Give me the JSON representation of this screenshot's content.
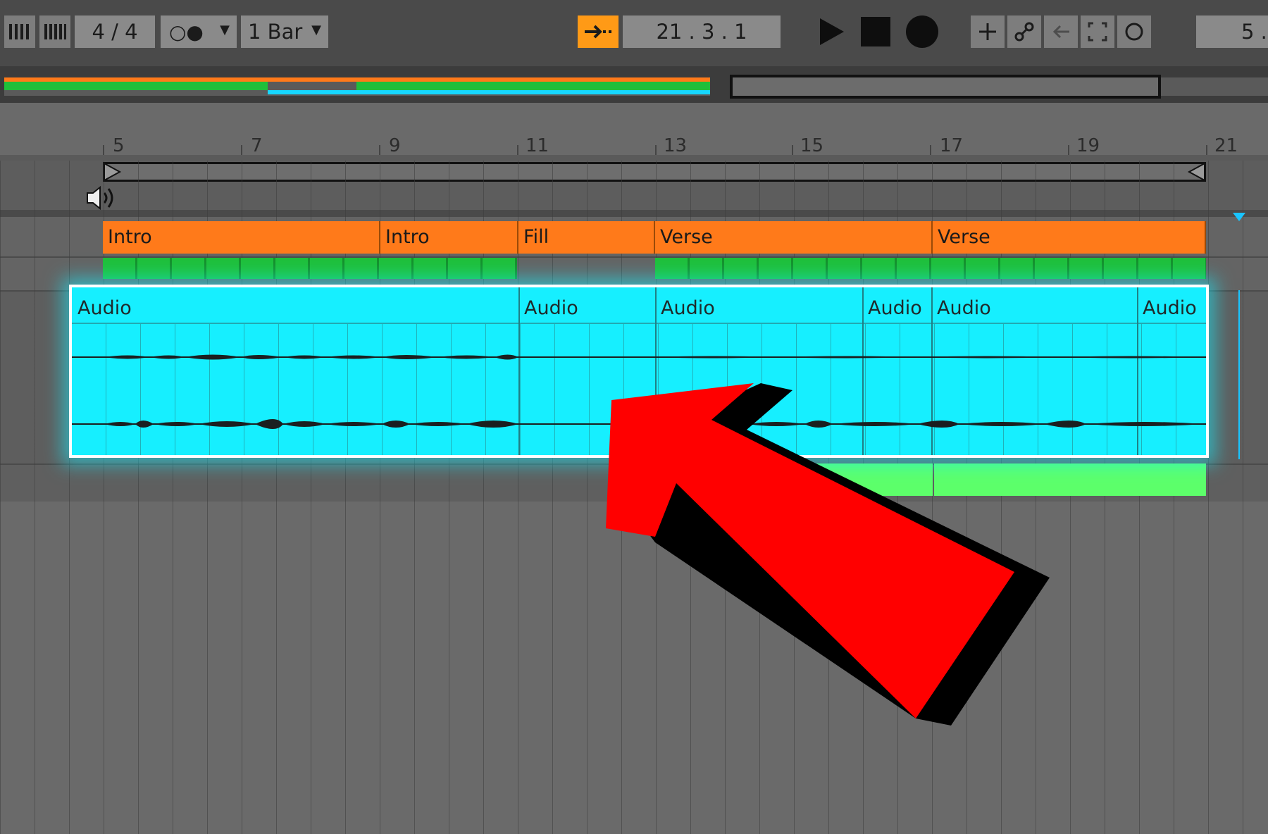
{
  "toolbar": {
    "time_signature": "4 / 4",
    "follow_glyph": "○●",
    "quantize": "1 Bar",
    "position": "21 .  3 .  1",
    "right_partial": "5 ."
  },
  "ruler": {
    "labels": [
      "5",
      "7",
      "9",
      "11",
      "13",
      "15",
      "17",
      "19",
      "21"
    ]
  },
  "sections": [
    "Intro",
    "Intro",
    "Fill",
    "Verse",
    "Verse"
  ],
  "audio_clips": [
    "Audio",
    "Audio",
    "Audio",
    "Audio",
    "Audio",
    "Audio"
  ],
  "colors": {
    "accent": "#ff8a00",
    "section": "#ff7a1a",
    "clip": "#16efff",
    "green": "#1fbf3a",
    "arrow": "#ff0000"
  }
}
